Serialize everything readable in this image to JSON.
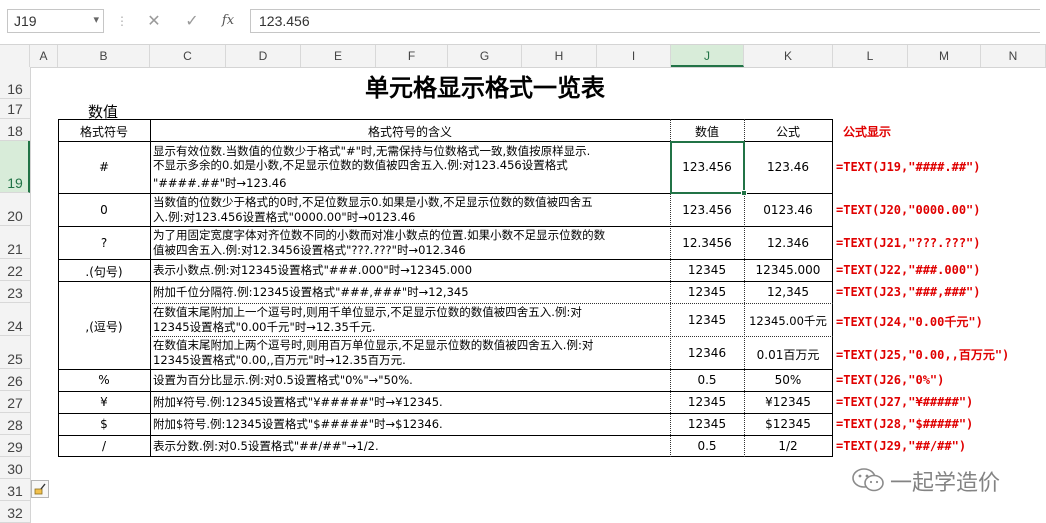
{
  "formula_bar": {
    "name_box": "J19",
    "cancel_icon": "✕",
    "enter_icon": "✓",
    "fx_label": "fx",
    "value": "123.456"
  },
  "columns": [
    "A",
    "B",
    "C",
    "D",
    "E",
    "F",
    "G",
    "H",
    "I",
    "J",
    "K",
    "L",
    "M",
    "N"
  ],
  "selected_column": "J",
  "rows": [
    "16",
    "17",
    "18",
    "19",
    "20",
    "21",
    "22",
    "23",
    "24",
    "25",
    "26",
    "27",
    "28",
    "29",
    "30",
    "31",
    "32"
  ],
  "selected_row": "19",
  "sheet": {
    "title": "单元格显示格式一览表",
    "subtitle": "数值",
    "headers": {
      "symbol": "格式符号",
      "meaning": "格式符号的含义",
      "value": "数值",
      "formula": "公式",
      "formula_display": "公式显示"
    },
    "entries": [
      {
        "symbol": "#",
        "meaning": [
          "显示有效位数.当数值的位数少于格式\"#\"时,无需保持与位数格式一致,数值按原样显示.",
          "不显示多余的0.如是小数,不足显示位数的数值被四舍五入.例:对123.456设置格式",
          "\"####.##\"时→123.46"
        ],
        "value": "123.456",
        "result": "123.46",
        "formula": "=TEXT(J19,\"####.##\")"
      },
      {
        "symbol": "0",
        "meaning": [
          "当数值的位数少于格式的0时,不足位数显示0.如果是小数,不足显示位数的数值被四舍五",
          "入.例:对123.456设置格式\"0000.00\"时→0123.46"
        ],
        "value": "123.456",
        "result": "0123.46",
        "formula": "=TEXT(J20,\"0000.00\")"
      },
      {
        "symbol": "?",
        "meaning": [
          "为了用固定宽度字体对齐位数不同的小数而对准小数点的位置.如果小数不足显示位数的数",
          "值被四舍五入.例:对12.3456设置格式\"???.???\"时→012.346"
        ],
        "value": "12.3456",
        "result": "12.346",
        "formula": "=TEXT(J21,\"???.???\")"
      },
      {
        "symbol": ".(句号)",
        "meaning": [
          "表示小数点.例:对12345设置格式\"###.000\"时→12345.000"
        ],
        "value": "12345",
        "result": "12345.000",
        "formula": "=TEXT(J22,\"###.000\")"
      },
      {
        "symbol": ",(逗号)",
        "meaning": [
          "附加千位分隔符.例:12345设置格式\"###,###\"时→12,345"
        ],
        "value": "12345",
        "result": "12,345",
        "formula": "=TEXT(J23,\"###,###\")"
      },
      {
        "symbol": "",
        "meaning": [
          "在数值末尾附加上一个逗号时,则用千单位显示,不足显示位数的数值被四舍五入.例:对",
          "12345设置格式\"0.00千元\"时→12.35千元."
        ],
        "value": "12345",
        "result": "12345.00千元",
        "formula": "=TEXT(J24,\"0.00千元\")"
      },
      {
        "symbol": "",
        "meaning": [
          "在数值末尾附加上两个逗号时,则用百万单位显示,不足显示位数的数值被四舍五入.例:对",
          "12345设置格式\"0.00,,百万元\"时→12.35百万元."
        ],
        "value": "12346",
        "result": "0.01百万元",
        "formula": "=TEXT(J25,\"0.00,,百万元\")"
      },
      {
        "symbol": "%",
        "meaning": [
          "设置为百分比显示.例:对0.5设置格式\"0%\"→\"50%."
        ],
        "value": "0.5",
        "result": "50%",
        "formula": "=TEXT(J26,\"0%\")"
      },
      {
        "symbol": "¥",
        "meaning": [
          "附加¥符号.例:12345设置格式\"¥#####\"时→¥12345."
        ],
        "value": "12345",
        "result": "¥12345",
        "formula": "=TEXT(J27,\"¥#####\")"
      },
      {
        "symbol": "$",
        "meaning": [
          "附加$符号.例:12345设置格式\"$#####\"时→$12346."
        ],
        "value": "12345",
        "result": "$12345",
        "formula": "=TEXT(J28,\"$#####\")"
      },
      {
        "symbol": "/",
        "meaning": [
          "表示分数.例:对0.5设置格式\"##/##\"→1/2."
        ],
        "value": "0.5",
        "result": "1/2",
        "formula": "=TEXT(J29,\"##/##\")"
      }
    ]
  },
  "watermark": "一起学造价",
  "colors": {
    "accent": "#217346",
    "formula_red": "#e00000"
  }
}
